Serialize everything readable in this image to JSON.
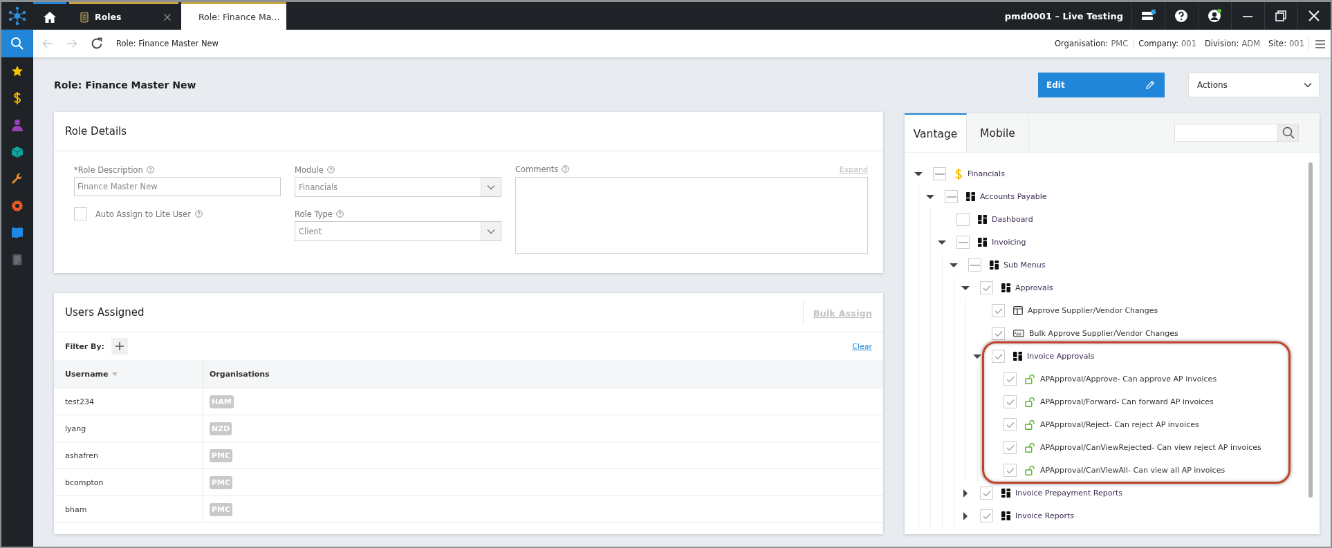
{
  "sidebar": {
    "items": [
      {
        "kind": "search",
        "selected": true
      },
      {
        "kind": "star",
        "selected": false
      },
      {
        "kind": "dollar",
        "selected": false
      },
      {
        "kind": "person",
        "selected": false
      },
      {
        "kind": "cube",
        "selected": false
      },
      {
        "kind": "wrench",
        "selected": false
      },
      {
        "kind": "gear",
        "selected": false
      },
      {
        "kind": "flag",
        "selected": false
      },
      {
        "kind": "document",
        "selected": false
      }
    ]
  },
  "tabs": [
    {
      "kind": "home",
      "selected": false
    },
    {
      "kind": "page",
      "label": "Roles",
      "selected": false
    },
    {
      "kind": "page",
      "label": "Role: Finance Ma…",
      "selected": true
    }
  ],
  "title_bar": {
    "environment": "pmd0001 – Live Testing"
  },
  "nav_bar": {
    "breadcrumb": "Role: Finance Master New",
    "context": [
      {
        "label": "Organisation:",
        "value": "PMC"
      },
      {
        "label": "Company:",
        "value": "001"
      },
      {
        "label": "Division:",
        "value": "ADM"
      },
      {
        "label": "Site:",
        "value": "001"
      }
    ]
  },
  "page": {
    "title": "Role: Finance Master New",
    "edit_button": "Edit",
    "actions": "Actions"
  },
  "role_details": {
    "title": "Role Details",
    "role_description": {
      "label": "*Role Description",
      "value": "Finance Master New"
    },
    "auto_assign": {
      "label": "Auto Assign to Lite User",
      "checked": false
    },
    "module": {
      "label": "Module",
      "value": "Financials"
    },
    "role_type": {
      "label": "Role Type",
      "value": "Client"
    },
    "comments": {
      "label": "Comments",
      "expand": "Expand"
    }
  },
  "users_assigned": {
    "title": "Users Assigned",
    "bulk_assign": "Bulk Assign",
    "filter_label": "Filter By:",
    "clear": "Clear",
    "columns": [
      "Username",
      "Organisations"
    ],
    "rows": [
      {
        "username": "test234",
        "organisation": "HAM"
      },
      {
        "username": "lyang",
        "organisation": "NZD"
      },
      {
        "username": "ashafren",
        "organisation": "PMC"
      },
      {
        "username": "bcompton",
        "organisation": "PMC"
      },
      {
        "username": "bham",
        "organisation": "PMC"
      }
    ]
  },
  "permissions": {
    "tabs": [
      {
        "label": "Vantage",
        "selected": true
      },
      {
        "label": "Mobile",
        "selected": false
      }
    ],
    "tree": [
      {
        "label": "Financials",
        "kind": "dollar",
        "checked": false,
        "indeterminate": true,
        "expanded": true,
        "children": [
          {
            "label": "Accounts Payable",
            "kind": "module",
            "checked": false,
            "indeterminate": true,
            "expanded": true,
            "children": [
              {
                "label": "Dashboard",
                "kind": "module",
                "checked": false,
                "indeterminate": false
              },
              {
                "label": "Invoicing",
                "kind": "module",
                "checked": false,
                "indeterminate": true,
                "expanded": true,
                "children": [
                  {
                    "label": "Sub Menus",
                    "kind": "module",
                    "checked": false,
                    "indeterminate": true,
                    "expanded": true,
                    "children": [
                      {
                        "label": "Approvals",
                        "kind": "module",
                        "checked": true,
                        "indeterminate": false,
                        "expanded": true,
                        "children": [
                          {
                            "label": "Approve Supplier/Vendor Changes",
                            "kind": "form",
                            "checked": true,
                            "indeterminate": false
                          },
                          {
                            "label": "Bulk Approve Supplier/Vendor Changes",
                            "kind": "keyboard",
                            "checked": true,
                            "indeterminate": false
                          },
                          {
                            "label": "Invoice Approvals",
                            "kind": "module",
                            "checked": true,
                            "indeterminate": false,
                            "expanded": true,
                            "highlighted": true,
                            "children": [
                              {
                                "label": "APApproval/Approve- Can approve AP invoices",
                                "kind": "lock",
                                "checked": true,
                                "indeterminate": false
                              },
                              {
                                "label": "APApproval/Forward- Can forward AP invoices",
                                "kind": "lock",
                                "checked": true,
                                "indeterminate": false
                              },
                              {
                                "label": "APApproval/Reject- Can reject AP invoices",
                                "kind": "lock",
                                "checked": true,
                                "indeterminate": false
                              },
                              {
                                "label": "APApproval/CanViewRejected- Can view reject AP invoices",
                                "kind": "lock",
                                "checked": true,
                                "indeterminate": false
                              },
                              {
                                "label": "APApproval/CanViewAll- Can view all AP invoices",
                                "kind": "lock",
                                "checked": true,
                                "indeterminate": false
                              }
                            ]
                          }
                        ]
                      },
                      {
                        "label": "Invoice Prepayment Reports",
                        "kind": "module",
                        "checked": true,
                        "indeterminate": false,
                        "expanded": false
                      },
                      {
                        "label": "Invoice Reports",
                        "kind": "module",
                        "checked": true,
                        "indeterminate": false,
                        "expanded": false
                      }
                    ]
                  }
                ]
              }
            ]
          }
        ]
      }
    ]
  }
}
